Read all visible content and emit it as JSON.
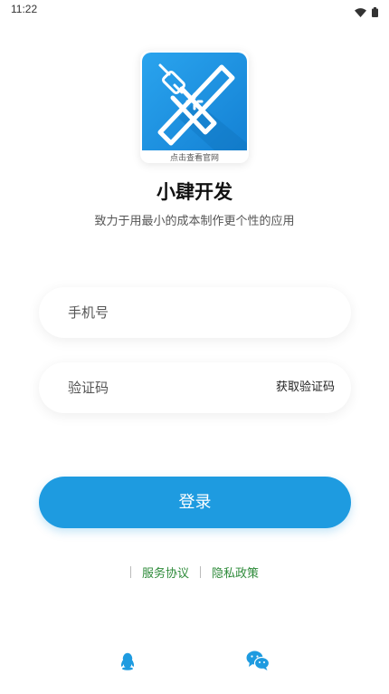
{
  "status_bar": {
    "time": "11:22",
    "icons": [
      "wifi-icon",
      "battery-icon"
    ]
  },
  "logo": {
    "caption": "点击查看官网",
    "icon": "crossed-tools-icon"
  },
  "app": {
    "name": "小肆开发",
    "slogan": "致力于用最小的成本制作更个性的应用"
  },
  "form": {
    "phone_placeholder": "手机号",
    "phone_value": "",
    "code_placeholder": "验证码",
    "code_value": "",
    "get_code_label": "获取验证码",
    "login_label": "登录"
  },
  "links": {
    "service_agreement": "服务协议",
    "privacy_policy": "隐私政策"
  },
  "social_login": [
    "qq-icon",
    "wechat-icon"
  ],
  "colors": {
    "primary": "#1e9be0",
    "link": "#2e8b3a",
    "logo_bg": "#1d8fe0"
  }
}
